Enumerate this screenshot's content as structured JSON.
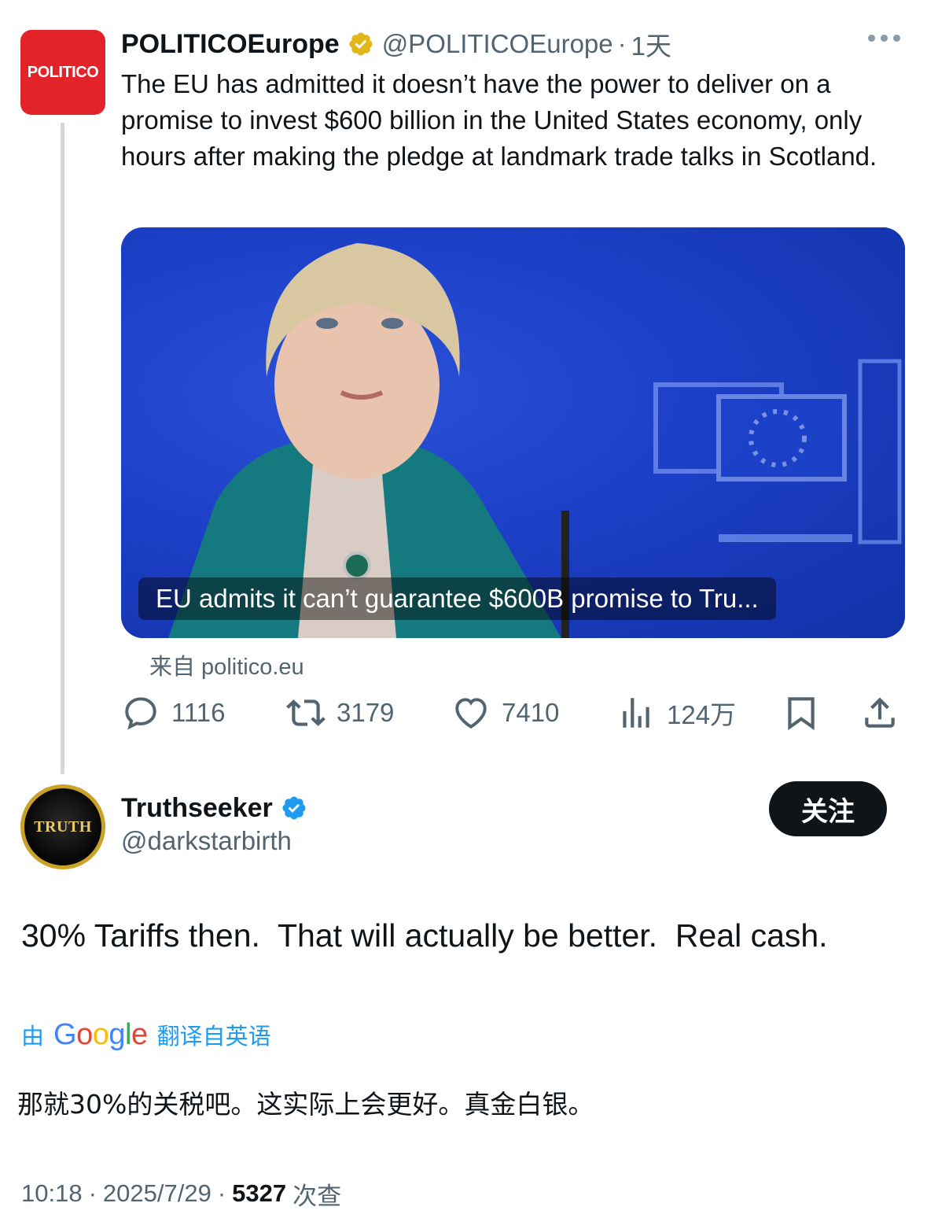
{
  "thread": {
    "parent": {
      "avatar_text": "POLITICO",
      "display_name": "POLITICOEurope",
      "handle": "@POLITICOEurope",
      "separator": "·",
      "time": "1天",
      "text": "The EU has admitted it doesn’t have the power to deliver on a promise to invest $600 billion in the United States economy, only hours after making the pledge at landmark trade talks in Scotland.",
      "card": {
        "caption": "EU admits it can’t guarantee $600B promise to Tru...",
        "source_label": "来自 politico.eu"
      },
      "stats": {
        "replies": "1116",
        "reposts": "3179",
        "likes": "7410",
        "views": "124万"
      },
      "verified_badge_color": "#e2b719"
    },
    "reply": {
      "avatar_text": "TRUTH",
      "display_name": "Truthseeker",
      "handle": "@darkstarbirth",
      "follow_label": "关注",
      "text": "30% Tariffs then.  That will actually be better.  Real cash.",
      "translate": {
        "prefix": "由",
        "provider": "Google",
        "suffix": "翻译自英语"
      },
      "translated_text": "那就30%的关税吧。这实际上会更好。真金白银。",
      "meta": {
        "time": "10:18",
        "date": "2025/7/29",
        "views_count": "5327",
        "views_label": "次查"
      },
      "verified_badge_color": "#1d9bf0"
    }
  },
  "colors": {
    "accent": "#1d9bf0",
    "politico_red": "#e2232a",
    "text_primary": "#0f1419",
    "text_secondary": "#536471"
  }
}
